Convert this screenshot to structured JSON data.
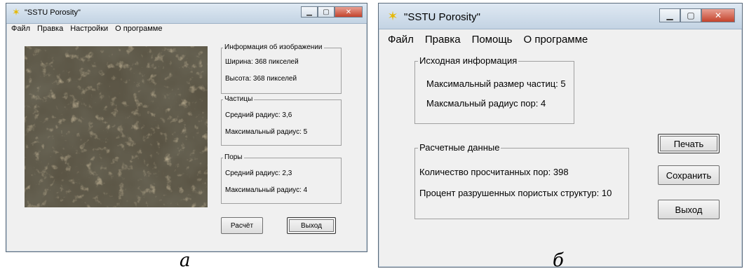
{
  "window_a": {
    "title": "\"SSTU Porosity\"",
    "menu": [
      "Файл",
      "Правка",
      "Настройки",
      "О программе"
    ],
    "image_info": {
      "legend": "Информация об изображении",
      "width": "Ширина: 368 пикселей",
      "height": "Высота: 368 пикселей"
    },
    "particles": {
      "legend": "Частицы",
      "avg_radius": "Средний радиус: 3,6",
      "max_radius": "Максимальный радиус: 5"
    },
    "pores": {
      "legend": "Поры",
      "avg_radius": "Средний радиус:  2,3",
      "max_radius": "Максимальный радиус: 4"
    },
    "calc_button": "Расчёт",
    "exit_button": "Выход",
    "caption": "а"
  },
  "window_b": {
    "title": "\"SSTU Porosity\"",
    "menu": [
      "Файл",
      "Правка",
      "Помощь",
      "О программе"
    ],
    "source_info": {
      "legend": "Исходная информация",
      "max_particle": "Максимальный размер частиц: 5",
      "max_pore": "Максмальный радиус пор: 4"
    },
    "calc_data": {
      "legend": "Расчетные данные",
      "pore_count": "Количество просчитанных пор: 398",
      "destroyed_percent": "Процент разрушенных пористых структур: 10"
    },
    "print_button": "Печать",
    "save_button": "Сохранить",
    "exit_button": "Выход",
    "caption": "б"
  },
  "icons": {
    "app": "app-logo-icon",
    "minimize": "minimize-icon",
    "maximize": "maximize-icon",
    "close": "close-icon"
  },
  "colors": {
    "close_button": "#c4432c",
    "window_bg": "#f0f0f0",
    "titlebar": "#c3d3e3"
  }
}
